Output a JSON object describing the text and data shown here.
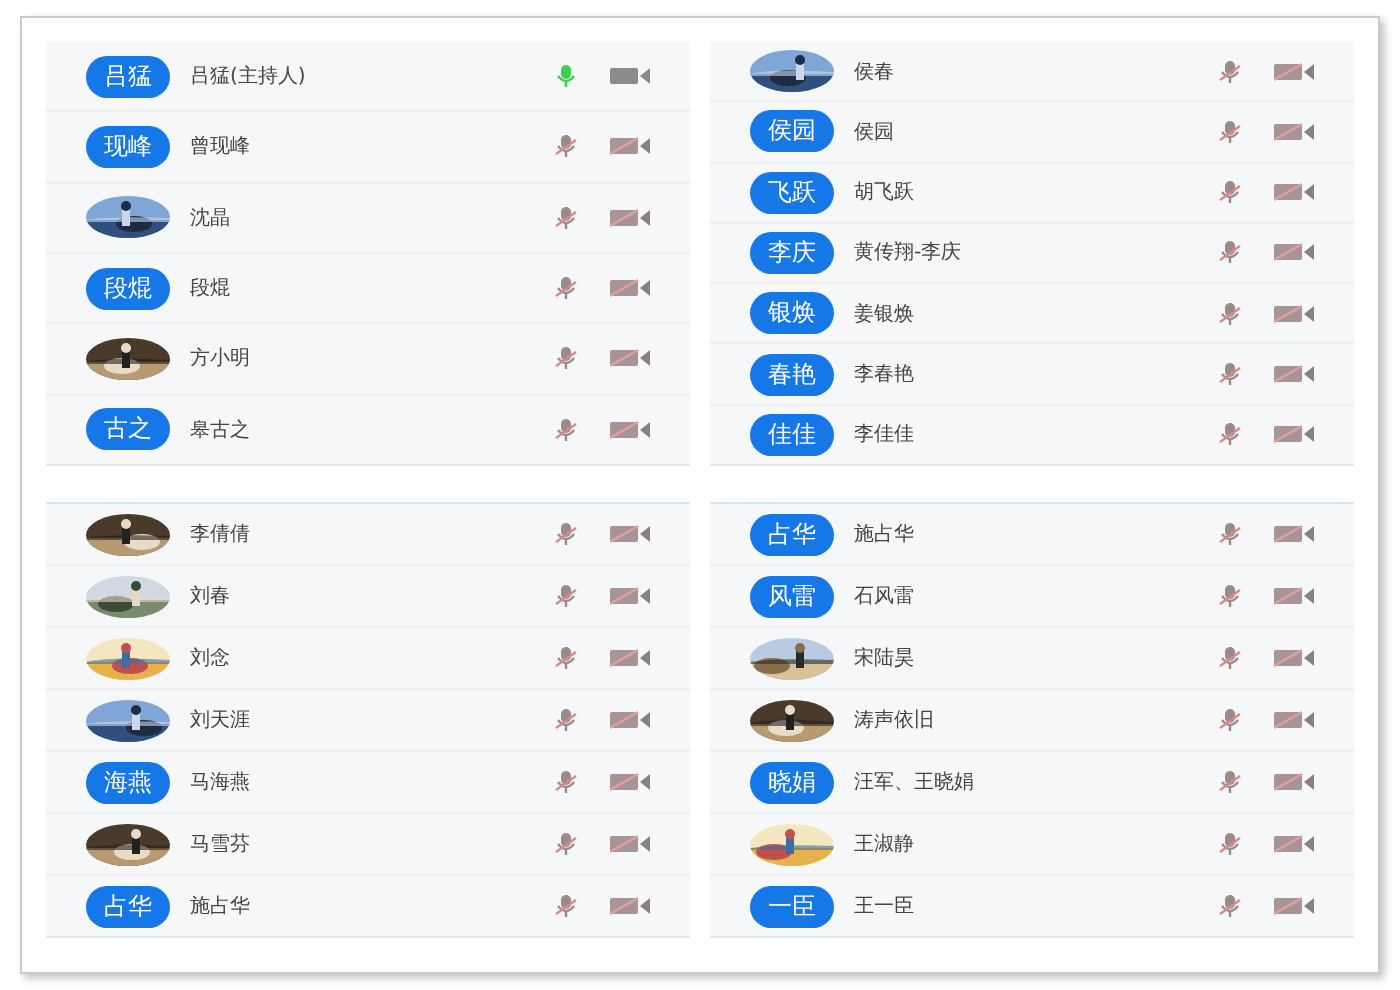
{
  "panels": [
    {
      "participants": [
        {
          "avatar": {
            "kind": "initials",
            "text": "吕猛"
          },
          "name": "吕猛(主持人)",
          "mic_on": true,
          "camera_on": true
        },
        {
          "avatar": {
            "kind": "initials",
            "text": "现峰"
          },
          "name": "曾现峰",
          "mic_on": false,
          "camera_on": false
        },
        {
          "name": "沈晶",
          "mic_on": false,
          "camera_on": false
        },
        {
          "avatar": {
            "kind": "initials",
            "text": "段焜"
          },
          "name": "段焜",
          "mic_on": false,
          "camera_on": false
        },
        {
          "name": "方小明",
          "mic_on": false,
          "camera_on": false
        },
        {
          "avatar": {
            "kind": "initials",
            "text": "古之"
          },
          "name": "皋古之",
          "mic_on": false,
          "camera_on": false
        }
      ]
    },
    {
      "participants": [
        {
          "name": "侯春",
          "mic_on": false,
          "camera_on": false
        },
        {
          "avatar": {
            "kind": "initials",
            "text": "侯园"
          },
          "name": "侯园",
          "mic_on": false,
          "camera_on": false
        },
        {
          "avatar": {
            "kind": "initials",
            "text": "飞跃"
          },
          "name": "胡飞跃",
          "mic_on": false,
          "camera_on": false
        },
        {
          "avatar": {
            "kind": "initials",
            "text": "李庆"
          },
          "name": "黄传翔-李庆",
          "mic_on": false,
          "camera_on": false
        },
        {
          "avatar": {
            "kind": "initials",
            "text": "银焕"
          },
          "name": "姜银焕",
          "mic_on": false,
          "camera_on": false
        },
        {
          "avatar": {
            "kind": "initials",
            "text": "春艳"
          },
          "name": "李春艳",
          "mic_on": false,
          "camera_on": false
        },
        {
          "avatar": {
            "kind": "initials",
            "text": "佳佳"
          },
          "name": "李佳佳",
          "mic_on": false,
          "camera_on": false
        }
      ]
    },
    {
      "participants": [
        {
          "name": "李倩倩",
          "mic_on": false,
          "camera_on": false
        },
        {
          "name": "刘春",
          "mic_on": false,
          "camera_on": false
        },
        {
          "name": "刘念",
          "mic_on": false,
          "camera_on": false
        },
        {
          "name": "刘天涯",
          "mic_on": false,
          "camera_on": false
        },
        {
          "avatar": {
            "kind": "initials",
            "text": "海燕"
          },
          "name": "马海燕",
          "mic_on": false,
          "camera_on": false
        },
        {
          "name": "马雪芬",
          "mic_on": false,
          "camera_on": false
        },
        {
          "avatar": {
            "kind": "initials",
            "text": "占华"
          },
          "name": "施占华",
          "mic_on": false,
          "camera_on": false
        }
      ]
    },
    {
      "participants": [
        {
          "avatar": {
            "kind": "initials",
            "text": "占华"
          },
          "name": "施占华",
          "mic_on": false,
          "camera_on": false
        },
        {
          "avatar": {
            "kind": "initials",
            "text": "风雷"
          },
          "name": "石风雷",
          "mic_on": false,
          "camera_on": false
        },
        {
          "name": "宋陆昊",
          "mic_on": false,
          "camera_on": false
        },
        {
          "name": "涛声依旧",
          "mic_on": false,
          "camera_on": false
        },
        {
          "avatar": {
            "kind": "initials",
            "text": "晓娟"
          },
          "name": "汪军、王晓娟",
          "mic_on": false,
          "camera_on": false
        },
        {
          "name": "王淑静",
          "mic_on": false,
          "camera_on": false
        },
        {
          "avatar": {
            "kind": "initials",
            "text": "一臣"
          },
          "name": "王一臣",
          "mic_on": false,
          "camera_on": false
        }
      ]
    }
  ]
}
